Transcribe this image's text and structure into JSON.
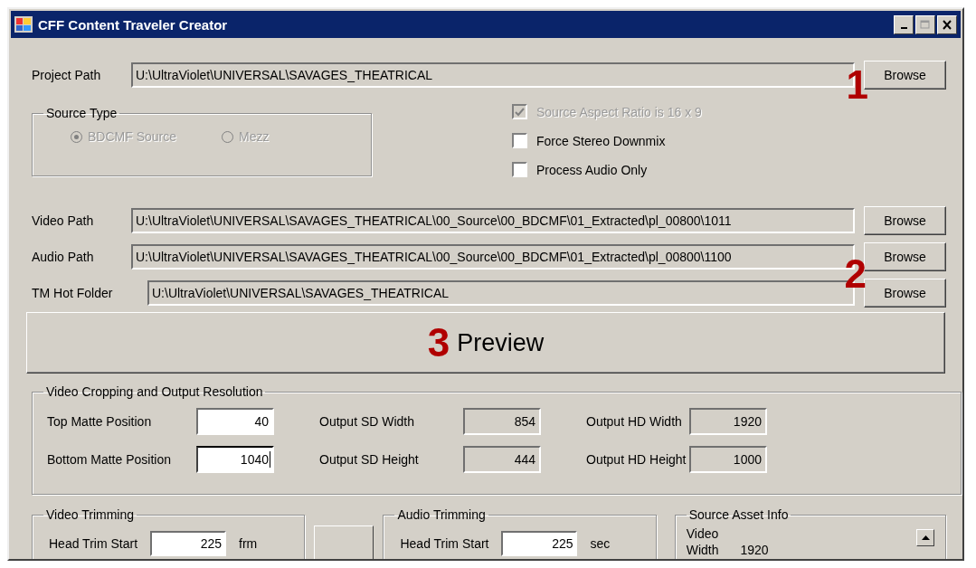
{
  "window": {
    "title": "CFF Content Traveler Creator"
  },
  "project_path": {
    "label": "Project Path",
    "value": "U:\\UltraViolet\\UNIVERSAL\\SAVAGES_THEATRICAL",
    "button": "Browse",
    "marker": "1"
  },
  "source_type": {
    "title": "Source Type",
    "options": [
      {
        "label": "BDCMF Source",
        "selected": true,
        "disabled": true
      },
      {
        "label": "Mezz",
        "selected": false,
        "disabled": true
      }
    ]
  },
  "options": [
    {
      "label": "Source Aspect Ratio is 16 x 9",
      "checked": true,
      "disabled": true
    },
    {
      "label": "Force Stereo Downmix",
      "checked": false,
      "disabled": false
    },
    {
      "label": "Process Audio Only",
      "checked": false,
      "disabled": false
    }
  ],
  "paths": [
    {
      "label": "Video Path",
      "value": "U:\\UltraViolet\\UNIVERSAL\\SAVAGES_THEATRICAL\\00_Source\\00_BDCMF\\01_Extracted\\pl_00800\\1011",
      "button": "Browse"
    },
    {
      "label": "Audio Path",
      "value": "U:\\UltraViolet\\UNIVERSAL\\SAVAGES_THEATRICAL\\00_Source\\00_BDCMF\\01_Extracted\\pl_00800\\1100",
      "button": "Browse",
      "marker": "2"
    },
    {
      "label": "TM Hot Folder",
      "value": "U:\\UltraViolet\\UNIVERSAL\\SAVAGES_THEATRICAL",
      "button": "Browse"
    }
  ],
  "preview": {
    "label": "Preview",
    "marker": "3"
  },
  "cropping": {
    "title": "Video Cropping and Output Resolution",
    "fields": [
      {
        "label": "Top Matte Position",
        "value": "40",
        "editable": true,
        "focused": false
      },
      {
        "label": "Output SD Width",
        "value": "854",
        "editable": false,
        "focused": false
      },
      {
        "label": "Output HD Width",
        "value": "1920",
        "editable": false,
        "focused": false
      },
      {
        "label": "Bottom Matte Position",
        "value": "1040",
        "editable": true,
        "focused": true
      },
      {
        "label": "Output SD Height",
        "value": "444",
        "editable": false,
        "focused": false
      },
      {
        "label": "Output HD Height",
        "value": "1000",
        "editable": false,
        "focused": false
      }
    ]
  },
  "video_trimming": {
    "title": "Video Trimming",
    "fields": [
      {
        "label": "Head Trim Start",
        "value": "225",
        "unit": "frm"
      }
    ]
  },
  "audio_trimming": {
    "title": "Audio Trimming",
    "fields": [
      {
        "label": "Head Trim Start",
        "value": "225",
        "unit": "sec"
      }
    ]
  },
  "source_asset_info": {
    "title": "Source Asset Info",
    "lines": [
      {
        "label": "Video"
      },
      {
        "label": "Width",
        "value": "1920"
      }
    ]
  }
}
